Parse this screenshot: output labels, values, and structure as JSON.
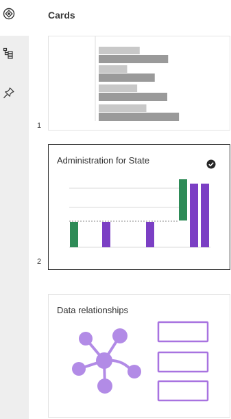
{
  "panel": {
    "title": "Cards",
    "icons": {
      "top": "circle-diamond-icon",
      "tree": "hierarchy-icon",
      "pin": "pin-icon"
    }
  },
  "cards": [
    {
      "number": "1",
      "title": "",
      "thumbnail": "gray-bar-chart",
      "chart_data": {
        "type": "bar",
        "orientation": "horizontal",
        "series": [
          {
            "values": [
              0.49,
              0.34,
              0.46,
              0.57
            ]
          },
          {
            "values": [
              0.83,
              0.67,
              0.82,
              0.96
            ]
          }
        ],
        "colors": [
          "#c8c8c8",
          "#9a9a9a"
        ]
      }
    },
    {
      "number": "2",
      "title": "Administration for State",
      "selected": true,
      "thumbnail": "waterfall-chart",
      "chart_data": {
        "type": "bar",
        "subtype": "waterfall",
        "values": [
          1,
          1,
          1,
          2,
          2.5,
          2.5
        ],
        "colors": [
          "#2e8b57",
          "#7b3fc4",
          "#7b3fc4",
          "#2e8b57",
          "#7b3fc4",
          "#7b3fc4"
        ]
      },
      "check_icon": "checkmark-filled-icon"
    },
    {
      "number": "",
      "title": "Data relationships",
      "thumbnail": "network-diagram",
      "accent": "#b28be6",
      "box_outline": "#a873e0"
    }
  ]
}
